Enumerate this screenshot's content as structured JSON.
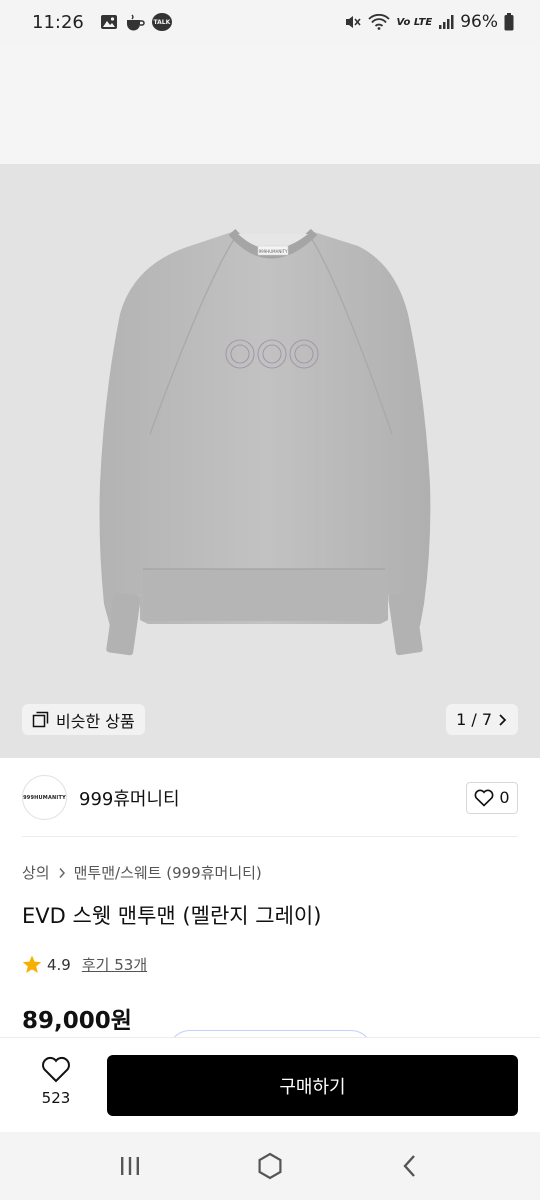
{
  "status_bar": {
    "time": "11:26",
    "talk_badge": "TALK",
    "network_label": "Vo LTE",
    "battery": "96%"
  },
  "product": {
    "image_alt": "EVD sweatshirt melange grey",
    "print_label": "999HUMANITY",
    "similar_label": "비슷한 상품",
    "page_indicator": "1 / 7"
  },
  "seller": {
    "avatar_text": "999HUMANITY",
    "name": "999휴머니티",
    "like_count": "0"
  },
  "breadcrumb": {
    "category": "상의",
    "subcategory": "맨투맨/스웨트 (999휴머니티)"
  },
  "title": "EVD 스웻 맨투맨 (멜란지 그레이)",
  "rating": {
    "score": "4.9",
    "reviews": "후기 53개"
  },
  "price": "89,000원",
  "bottom_bar": {
    "wish_count": "523",
    "buy_label": "구매하기"
  },
  "colors": {
    "accent": "#000000",
    "star": "#f5b000",
    "image_bg": "#e3e3e3",
    "sweatshirt": "#bdbdbd"
  }
}
